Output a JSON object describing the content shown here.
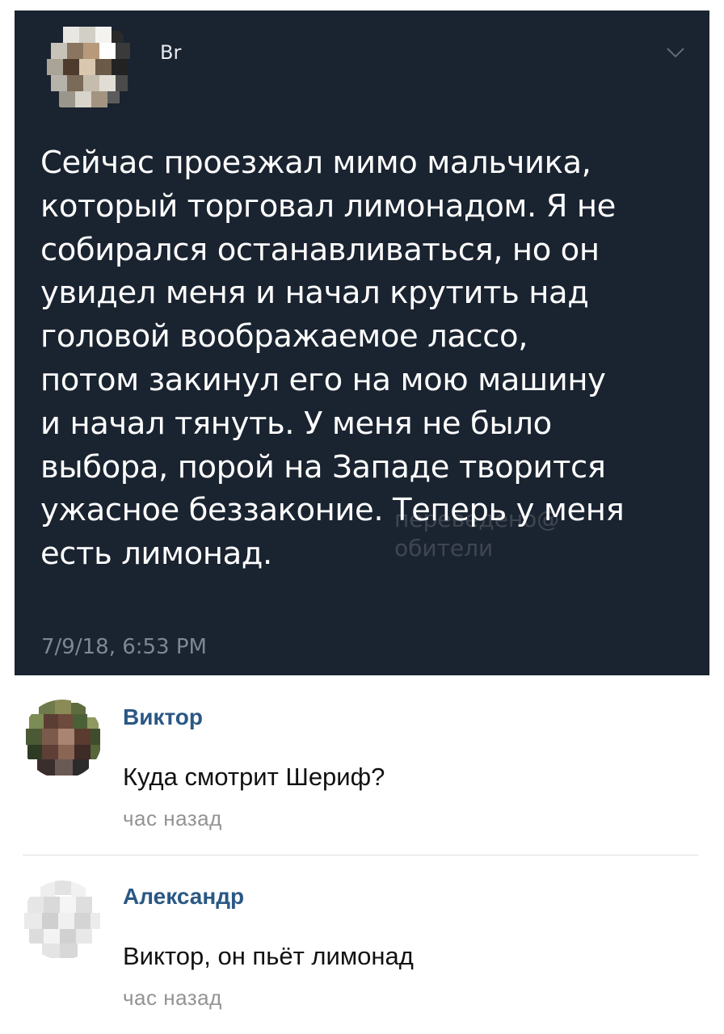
{
  "tweet": {
    "username": "Br",
    "lines": [
      "Сейчас проезжал мимо мальчика,",
      "который торговал лимонадом. Я не",
      "собирался останавливаться, но он",
      "увидел меня и начал крутить над",
      "головой воображаемое лассо,",
      "потом закинул его на мою машину",
      "и начал тянуть. У меня не было",
      "выбора, порой на Западе творится",
      "ужасное беззаконие. Теперь у меня",
      "есть лимонад."
    ],
    "timestamp": "7/9/18, 6:53 PM",
    "watermark": [
      "переведено@",
      "обители"
    ]
  },
  "comments": [
    {
      "author": "Виктор",
      "text": "Куда смотрит Шериф?",
      "time": "час назад"
    },
    {
      "author": "Александр",
      "text": "Виктор, он пьёт лимонад",
      "time": "час назад"
    }
  ],
  "colors": {
    "card_background": "#1a2330",
    "author_link": "#2a5885",
    "time_gray": "#939393"
  },
  "icons": {
    "chevron": "chevron-down-icon",
    "tweet_avatar": "pixelated-avatar",
    "comment_avatar": "pixelated-avatar"
  }
}
